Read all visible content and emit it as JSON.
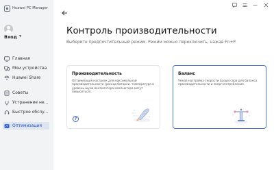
{
  "app": {
    "title": "Huawei PC Manager"
  },
  "sidebar": {
    "login_label": "Вход",
    "groups": [
      [
        {
          "label": "Главная",
          "icon": "home-icon"
        },
        {
          "label": "Мои устройства",
          "icon": "devices-icon"
        },
        {
          "label": "Huawei Share",
          "icon": "share-icon"
        }
      ],
      [
        {
          "label": "Советы",
          "icon": "tips-icon"
        },
        {
          "label": "Устранение не...",
          "icon": "troubleshoot-icon"
        },
        {
          "label": "Быстрое обслу...",
          "icon": "quick-service-icon"
        }
      ],
      [
        {
          "label": "Оптимизация",
          "icon": "optimization-icon",
          "active": true
        }
      ]
    ]
  },
  "main": {
    "title": "Контроль производительности",
    "subtitle": "Выберите предпочтительный режим. Режим можно переключить, нажав Fn+P.",
    "cards": [
      {
        "id": "performance",
        "title": "Производительность",
        "description": "Оптимизация настроек для максимальной производительности (расход батареи, температура и уровень шума вентилятора компьютера могут повыситься).",
        "selected": false
      },
      {
        "id": "balance",
        "title": "Баланс",
        "description": "Умная настройка скорости процессора для баланса производительности и энергопотребления.",
        "selected": true
      }
    ]
  },
  "colors": {
    "accent": "#1a4fd6",
    "selected_border": "#4a73c8",
    "sidebar_bg": "#f2f3f5",
    "active_item_bg": "#dde3ef"
  }
}
